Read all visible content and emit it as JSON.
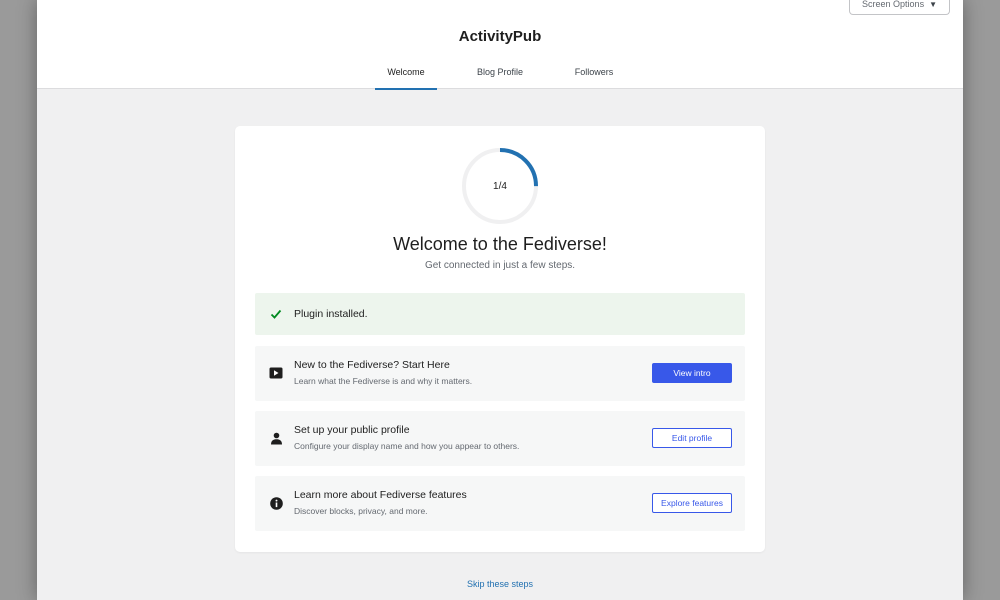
{
  "screen_options": {
    "label": "Screen Options",
    "arrow": "▼"
  },
  "app": {
    "title": "ActivityPub"
  },
  "tabs": [
    {
      "label": "Welcome",
      "active": true
    },
    {
      "label": "Blog Profile",
      "active": false
    },
    {
      "label": "Followers",
      "active": false
    }
  ],
  "progress": {
    "label": "1/4",
    "current": 1,
    "total": 4
  },
  "welcome": {
    "title": "Welcome to the Fediverse!",
    "subtitle": "Get connected in just a few steps."
  },
  "steps": [
    {
      "icon": "checkmark-icon",
      "title": "Plugin installed.",
      "status": "done"
    },
    {
      "icon": "video-icon",
      "title": "New to the Fediverse? Start Here",
      "description": "Learn what the Fediverse is and why it matters.",
      "button": "View intro",
      "button_style": "primary"
    },
    {
      "icon": "person-icon",
      "title": "Set up your public profile",
      "description": "Configure your display name and how you appear to others.",
      "button": "Edit profile",
      "button_style": "secondary"
    },
    {
      "icon": "info-icon",
      "title": "Learn more about Fediverse features",
      "description": "Discover blocks, privacy, and more.",
      "button": "Explore features",
      "button_style": "secondary"
    }
  ],
  "skip": {
    "label": "Skip these steps"
  },
  "colors": {
    "accent": "#3858e9",
    "tab_underline": "#2271b1",
    "success": "#008a20",
    "progress_track": "#f0f0f1",
    "progress_fill": "#2271b1"
  }
}
